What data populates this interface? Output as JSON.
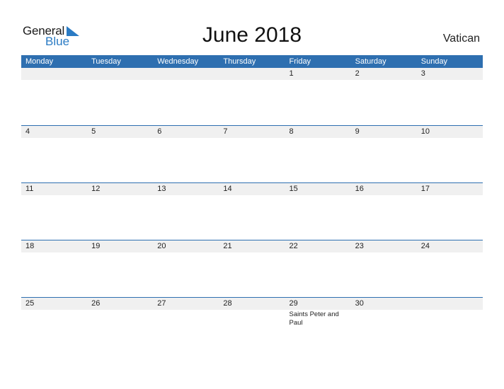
{
  "logo": {
    "general": "General",
    "blue": "Blue"
  },
  "title": "June 2018",
  "country": "Vatican",
  "colors": {
    "accent": "#2e6fb0",
    "strip": "#f0f0f0",
    "logo_blue": "#2a7bc4"
  },
  "weekdays": [
    "Monday",
    "Tuesday",
    "Wednesday",
    "Thursday",
    "Friday",
    "Saturday",
    "Sunday"
  ],
  "weeks": [
    [
      "",
      "",
      "",
      "",
      "1",
      "2",
      "3"
    ],
    [
      "4",
      "5",
      "6",
      "7",
      "8",
      "9",
      "10"
    ],
    [
      "11",
      "12",
      "13",
      "14",
      "15",
      "16",
      "17"
    ],
    [
      "18",
      "19",
      "20",
      "21",
      "22",
      "23",
      "24"
    ],
    [
      "25",
      "26",
      "27",
      "28",
      "29",
      "30",
      ""
    ]
  ],
  "events": {
    "29": "Saints Peter and Paul"
  }
}
